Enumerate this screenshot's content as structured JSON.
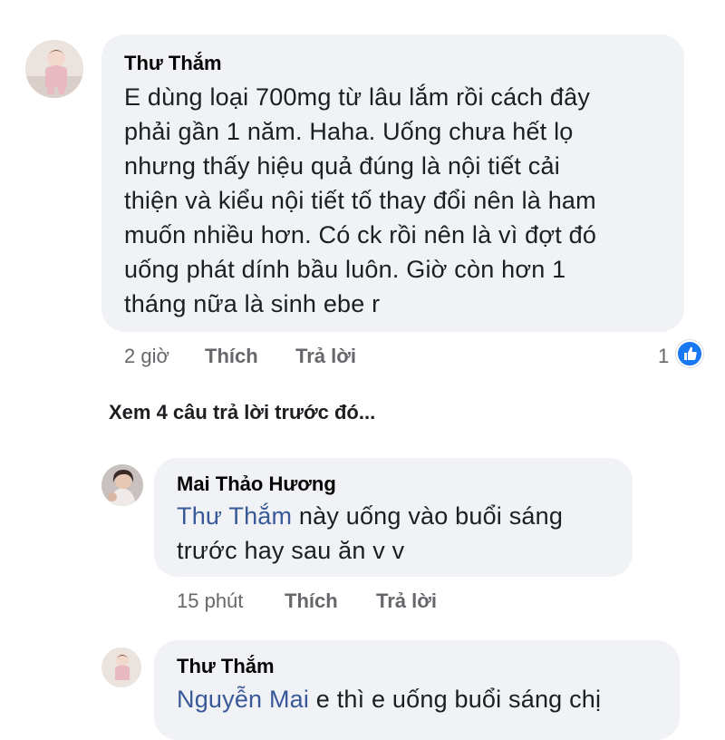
{
  "comments": [
    {
      "author": "Thư Thắm",
      "lines": [
        "E dùng loại 700mg từ lâu lắm rồi cách đây",
        "phải gần 1 năm. Haha. Uống chưa hết lọ",
        "nhưng thấy hiệu quả đúng là nội tiết cải",
        "thiện và kiểu nội tiết tố thay đổi nên là ham",
        "muốn nhiều hơn. Có ck rồi nên là vì đợt đó",
        "uống phát dính bầu luôn. Giờ còn hơn 1",
        "tháng nữa là sinh ebe r"
      ],
      "time": "2 giờ",
      "like_label": "Thích",
      "reply_label": "Trả lời",
      "reaction_count": "1",
      "reaction_icon": "like-thumb-icon"
    }
  ],
  "see_previous": "Xem 4 câu trả lời trước đó...",
  "replies": [
    {
      "author": "Mai Thảo Hương",
      "mention": "Thư Thắm",
      "line1_rest": " này uống vào buổi sáng",
      "line2": "trước hay sau ăn v v",
      "time": "15 phút",
      "like_label": "Thích",
      "reply_label": "Trả lời"
    },
    {
      "author": "Thư Thắm",
      "mention": "Nguyễn Mai",
      "line1_rest": " e thì e uống buổi sáng chị"
    }
  ],
  "colors": {
    "bubble": "#f0f2f5",
    "mention": "#385898",
    "meta": "#65676b",
    "like_blue": "#1877f2"
  }
}
